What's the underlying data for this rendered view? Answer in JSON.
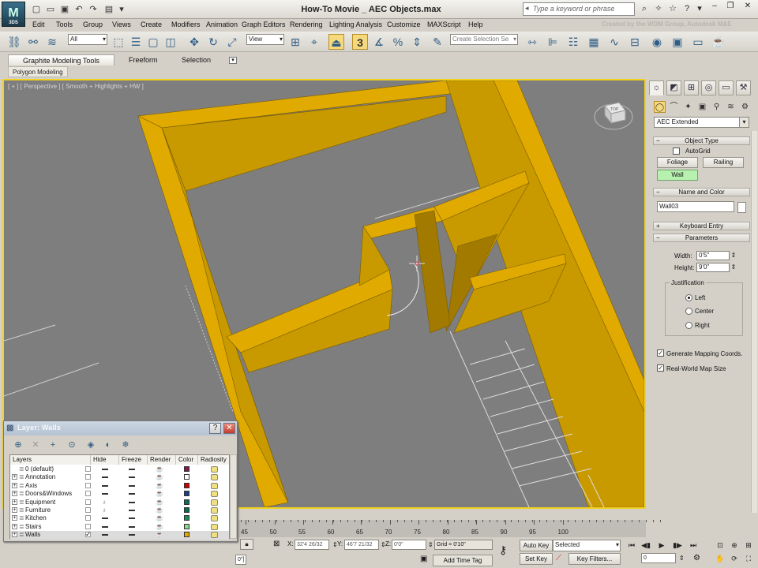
{
  "window": {
    "title": "How-To Movie _ AEC Objects.max",
    "logo_text": "M",
    "logo_version": "3DS",
    "search_placeholder": "Type a keyword or phrase",
    "watermark": "Created by the WDM Group, Autodesk M&E"
  },
  "menu": [
    "Edit",
    "Tools",
    "Group",
    "Views",
    "Create",
    "Modifiers",
    "Animation",
    "Graph Editors",
    "Rendering",
    "Lighting Analysis",
    "Customize",
    "MAXScript",
    "Help"
  ],
  "toolbar": {
    "selection_filter": "All",
    "reference_coord": "View",
    "named_selection_placeholder": "Create Selection Se",
    "snap_label": "3"
  },
  "ribbon": {
    "tabs": [
      "Graphite Modeling Tools",
      "Freeform",
      "Selection"
    ],
    "subtab": "Polygon Modeling"
  },
  "viewport": {
    "label": "[ + ] [ Perspective ] [ Smooth + Highlights + HW ]",
    "viewcube_face": "TOP",
    "colors": {
      "wall": "#c89a00",
      "wall_top": "#e0aa00",
      "wall_dark": "#a27a00",
      "floor": "#7e7e7e",
      "border": "#f0d21f"
    }
  },
  "command_panel": {
    "category": "AEC Extended",
    "rollouts": {
      "object_type": "Object Type",
      "name_and_color": "Name and Color",
      "keyboard_entry": "Keyboard Entry",
      "parameters": "Parameters"
    },
    "autogrid_label": "AutoGrid",
    "buttons": [
      "Foliage",
      "Railing",
      "Wall"
    ],
    "active_button": "Wall",
    "object_name": "Wall03",
    "object_color": "#ffffff",
    "width_label": "Width:",
    "width_value": "0'5\"",
    "height_label": "Height:",
    "height_value": "9'0\"",
    "justification_label": "Justification",
    "justification_options": [
      "Left",
      "Center",
      "Right"
    ],
    "justification_selected": "Left",
    "gen_mapping_label": "Generate Mapping Coords.",
    "real_world_label": "Real-World Map Size"
  },
  "layer_dialog": {
    "title": "Layer: Walls",
    "columns": [
      "Layers",
      "Hide",
      "Freeze",
      "Render",
      "Color",
      "Radiosity"
    ],
    "rows": [
      {
        "name": "0 (default)",
        "color": "#7a1f4a",
        "expandable": false,
        "selected": false,
        "current": false,
        "hidden": false
      },
      {
        "name": "Annotation",
        "color": "#ffffff",
        "expandable": true,
        "selected": false,
        "current": false,
        "hidden": false
      },
      {
        "name": "Axis",
        "color": "#cc0000",
        "expandable": true,
        "selected": false,
        "current": false,
        "hidden": false
      },
      {
        "name": "Doors&Windows",
        "color": "#1a3f8a",
        "expandable": true,
        "selected": false,
        "current": false,
        "hidden": false
      },
      {
        "name": "Equipment",
        "color": "#0e6b55",
        "expandable": true,
        "selected": false,
        "current": false,
        "hidden": true
      },
      {
        "name": "Furniture",
        "color": "#0b6b4f",
        "expandable": true,
        "selected": false,
        "current": false,
        "hidden": true
      },
      {
        "name": "Kitchen",
        "color": "#1a8a5a",
        "expandable": true,
        "selected": false,
        "current": false,
        "hidden": false
      },
      {
        "name": "Stairs",
        "color": "#8fd68f",
        "expandable": true,
        "selected": false,
        "current": false,
        "hidden": false
      },
      {
        "name": "Walls",
        "color": "#e0a800",
        "expandable": true,
        "selected": true,
        "current": true,
        "hidden": false
      }
    ]
  },
  "timeline": {
    "ticks": [
      "45",
      "50",
      "55",
      "60",
      "65",
      "70",
      "75",
      "80",
      "85",
      "90",
      "95",
      "100"
    ]
  },
  "statusbar": {
    "x_label": "X:",
    "x_value": "32'4 26/32",
    "y_label": "Y:",
    "y_value": "46'7 21/32",
    "z_label": "Z:",
    "z_value": "0'0\"",
    "grid": "Grid = 0'10\"",
    "add_time_tag": "Add Time Tag",
    "auto_key": "Auto Key",
    "set_key": "Set Key",
    "selected_dropdown": "Selected",
    "key_filters": "Key Filters...",
    "frame_value": "0",
    "prompt_fragment": "0\"]"
  }
}
